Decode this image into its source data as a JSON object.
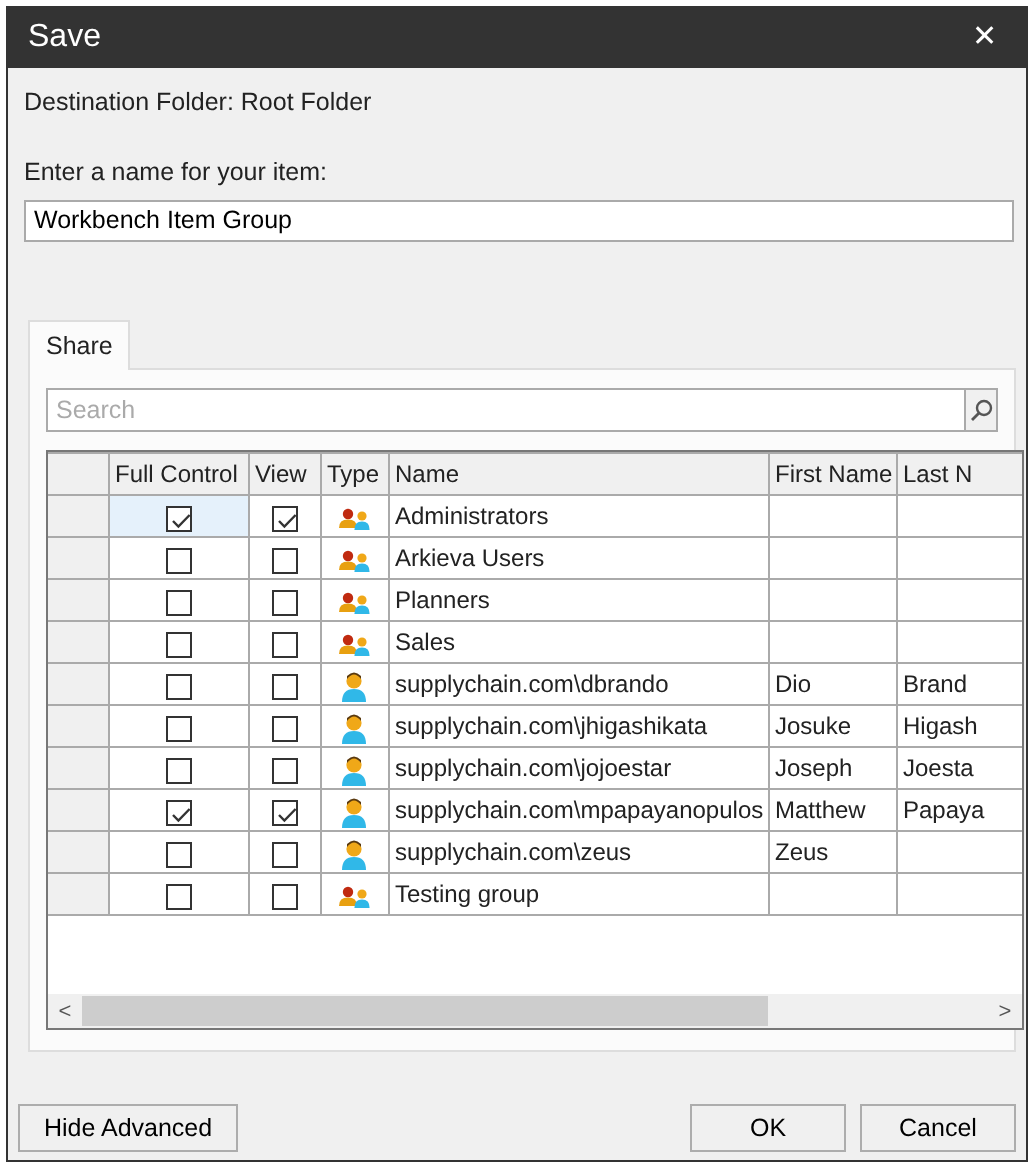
{
  "window": {
    "title": "Save",
    "close": "✕"
  },
  "destination": "Destination Folder: Root Folder",
  "name_field": {
    "label": "Enter a name for your item:",
    "value": "Workbench Item Group"
  },
  "tabs": [
    {
      "label": "Share",
      "selected": true
    }
  ],
  "search": {
    "placeholder": "Search"
  },
  "grid": {
    "columns": [
      "Full Control",
      "View",
      "Type",
      "Name",
      "First Name",
      "Last N"
    ],
    "rows": [
      {
        "selected": true,
        "full_control": true,
        "view": true,
        "kind": "group",
        "name": "Administrators",
        "first_name": "",
        "last_name": ""
      },
      {
        "selected": false,
        "full_control": false,
        "view": false,
        "kind": "group",
        "name": "Arkieva Users",
        "first_name": "",
        "last_name": ""
      },
      {
        "selected": false,
        "full_control": false,
        "view": false,
        "kind": "group",
        "name": "Planners",
        "first_name": "",
        "last_name": ""
      },
      {
        "selected": false,
        "full_control": false,
        "view": false,
        "kind": "group",
        "name": "Sales",
        "first_name": "",
        "last_name": ""
      },
      {
        "selected": false,
        "full_control": false,
        "view": false,
        "kind": "user",
        "name": "supplychain.com\\dbrando",
        "first_name": "Dio",
        "last_name": "Brand"
      },
      {
        "selected": false,
        "full_control": false,
        "view": false,
        "kind": "user",
        "name": "supplychain.com\\jhigashikata",
        "first_name": "Josuke",
        "last_name": "Higash"
      },
      {
        "selected": false,
        "full_control": false,
        "view": false,
        "kind": "user",
        "name": "supplychain.com\\jojoestar",
        "first_name": "Joseph",
        "last_name": "Joesta"
      },
      {
        "selected": false,
        "full_control": true,
        "view": true,
        "kind": "user",
        "name": "supplychain.com\\mpapayanopulos",
        "first_name": "Matthew",
        "last_name": "Papaya"
      },
      {
        "selected": false,
        "full_control": false,
        "view": false,
        "kind": "user",
        "name": "supplychain.com\\zeus",
        "first_name": "Zeus",
        "last_name": ""
      },
      {
        "selected": false,
        "full_control": false,
        "view": false,
        "kind": "group",
        "name": "Testing group",
        "first_name": "",
        "last_name": ""
      }
    ]
  },
  "scrollbar": {
    "left": "<",
    "right": ">"
  },
  "buttons": [
    {
      "label": "Hide Advanced",
      "kind": "left"
    },
    {
      "label": "OK",
      "kind": "right"
    },
    {
      "label": "Cancel",
      "kind": "right"
    }
  ]
}
